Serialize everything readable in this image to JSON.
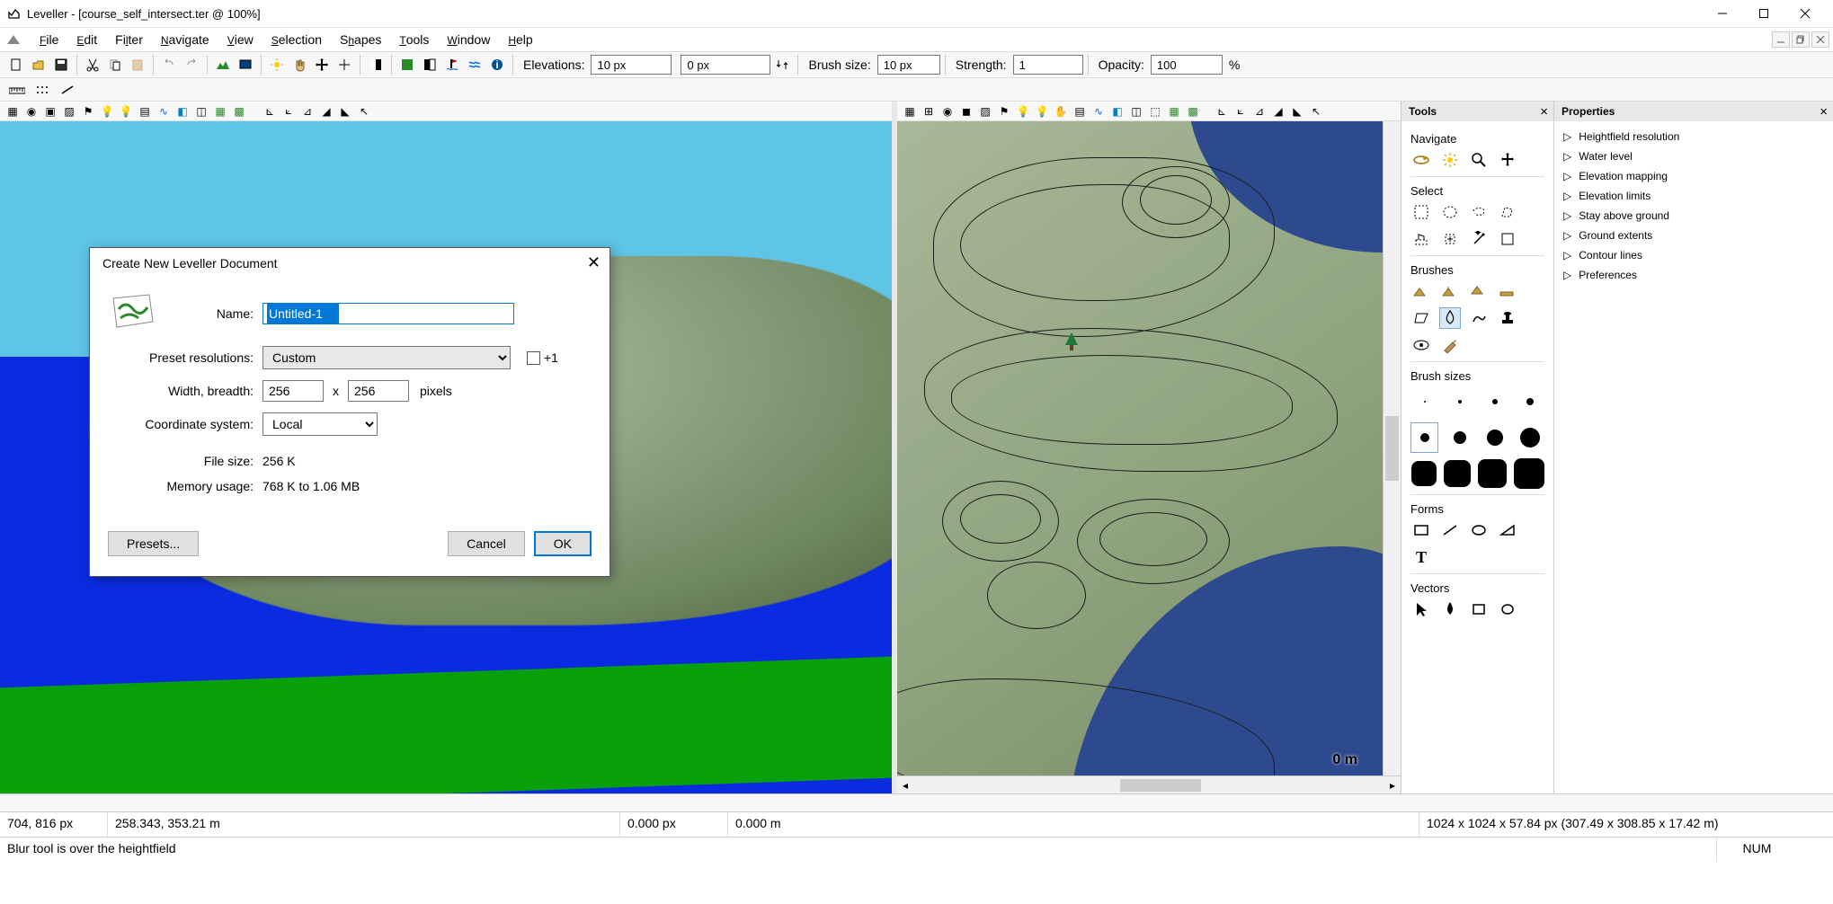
{
  "title": "Leveller - [course_self_intersect.ter @ 100%]",
  "menus": [
    "File",
    "Edit",
    "Filter",
    "Navigate",
    "View",
    "Selection",
    "Shapes",
    "Tools",
    "Window",
    "Help"
  ],
  "toolbar": {
    "elevations_label": "Elevations:",
    "elev_high": "10 px",
    "elev_low": "0 px",
    "brushsize_label": "Brush size:",
    "brushsize": "10 px",
    "strength_label": "Strength:",
    "strength": "1",
    "opacity_label": "Opacity:",
    "opacity": "100",
    "opacity_pct": "%"
  },
  "view2d": {
    "scale": "0 m"
  },
  "tools_panel": {
    "title": "Tools",
    "navigate": "Navigate",
    "select": "Select",
    "brushes": "Brushes",
    "brush_sizes": "Brush sizes",
    "forms": "Forms",
    "vectors": "Vectors"
  },
  "props_panel": {
    "title": "Properties",
    "items": [
      "Heightfield resolution",
      "Water level",
      "Elevation mapping",
      "Elevation limits",
      "Stay above ground",
      "Ground extents",
      "Contour lines",
      "Preferences"
    ]
  },
  "dialog": {
    "title": "Create New Leveller Document",
    "name_label": "Name:",
    "name_value": "Untitled-1",
    "preset_label": "Preset resolutions:",
    "preset_value": "Custom",
    "plus1": "+1",
    "wb_label": "Width, breadth:",
    "width": "256",
    "x": "x",
    "breadth": "256",
    "pixels": "pixels",
    "coord_label": "Coordinate system:",
    "coord_value": "Local",
    "filesize_label": "File size:",
    "filesize_value": "256 K",
    "mem_label": "Memory usage:",
    "mem_value": "768 K to 1.06 MB",
    "presets_btn": "Presets...",
    "cancel_btn": "Cancel",
    "ok_btn": "OK"
  },
  "status1": {
    "coord_px": "704, 816 px",
    "coord_m": "258.343, 353.21 m",
    "zero_px": "0.000 px",
    "zero_m": "0.000 m",
    "dims": "1024 x 1024 x 57.84 px (307.49 x 308.85 x 17.42 m)"
  },
  "status2": {
    "hint": "Blur tool is over the heightfield",
    "num": "NUM"
  }
}
